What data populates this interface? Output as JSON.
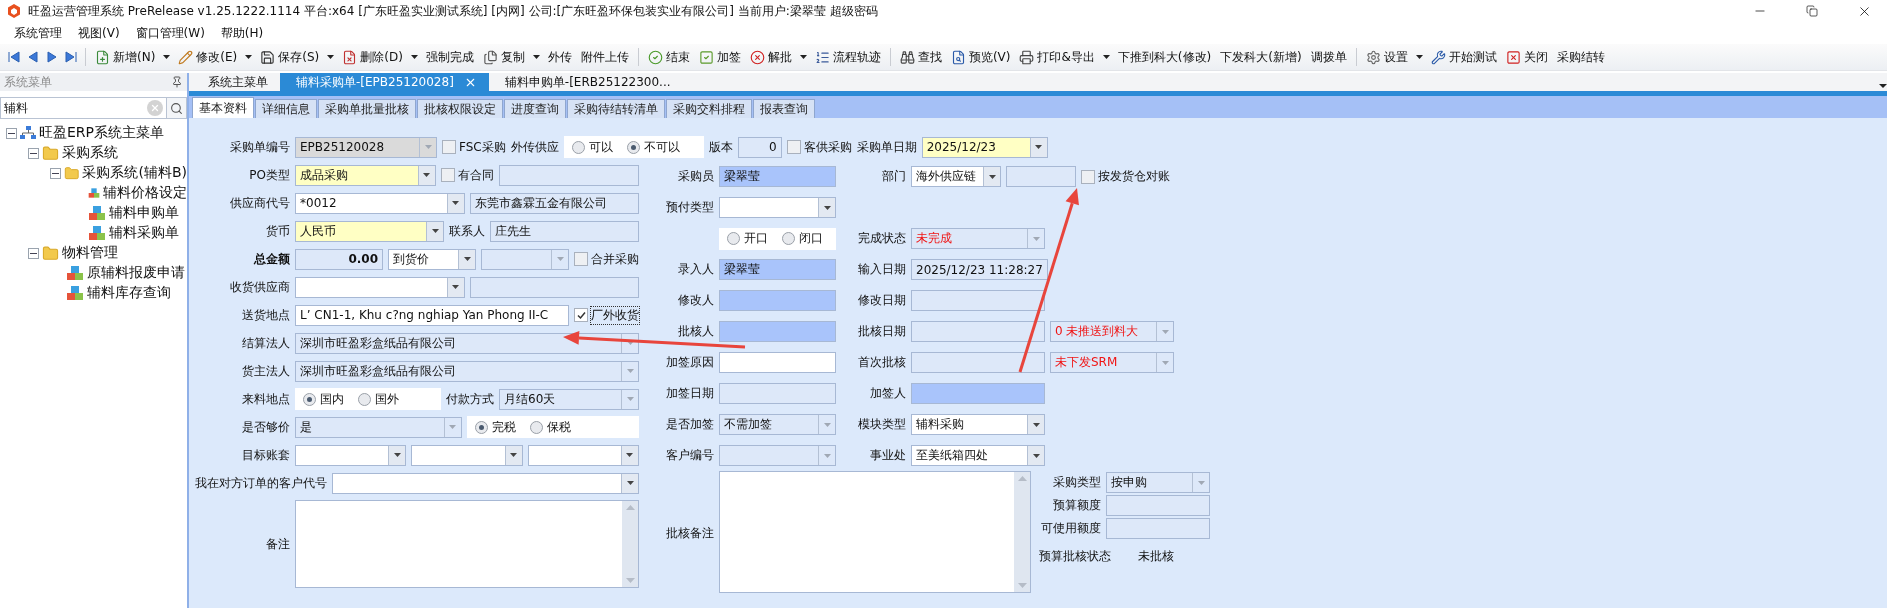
{
  "title_bar": {
    "title": "旺盈运营管理系统 PreRelease v1.25.1222.1114 平台:x64  [广东旺盈实业测试系统] [内网] 公司:[广东旺盈环保包装实业有限公司] 当前用户:梁翠莹  超级密码"
  },
  "menu": [
    "系统管理",
    "视图(V)",
    "窗口管理(W)",
    "帮助(H)"
  ],
  "toolbar": [
    {
      "kind": "separator"
    },
    {
      "kind": "button",
      "label": "新增(N)",
      "dropdown": true
    },
    {
      "kind": "button",
      "label": "修改(E)",
      "dropdown": true
    },
    {
      "kind": "button",
      "label": "保存(S)",
      "dropdown": true
    },
    {
      "kind": "button",
      "label": "删除(D)",
      "dropdown": true
    },
    {
      "kind": "button",
      "label": "强制完成",
      "dropdown": false
    },
    {
      "kind": "button",
      "label": "复制",
      "dropdown": true
    },
    {
      "kind": "button",
      "label": "外传",
      "dropdown": false
    },
    {
      "kind": "button",
      "label": "附件上传",
      "dropdown": false
    },
    {
      "kind": "separator"
    },
    {
      "kind": "button",
      "label": "结束",
      "dropdown": false
    },
    {
      "kind": "button",
      "label": "加签",
      "dropdown": false
    },
    {
      "kind": "button",
      "label": "解批",
      "dropdown": true
    },
    {
      "kind": "button",
      "label": "流程轨迹",
      "dropdown": false
    },
    {
      "kind": "separator"
    },
    {
      "kind": "button",
      "label": "查找",
      "dropdown": false
    },
    {
      "kind": "button",
      "label": "预览(V)",
      "dropdown": false
    },
    {
      "kind": "button",
      "label": "打印&导出",
      "dropdown": true
    },
    {
      "kind": "button",
      "label": "下推到科大(修改)",
      "dropdown": false
    },
    {
      "kind": "button",
      "label": "下发科大(新增)",
      "dropdown": false
    },
    {
      "kind": "button",
      "label": "调拨单",
      "dropdown": false
    },
    {
      "kind": "separator"
    },
    {
      "kind": "button",
      "label": "设置",
      "dropdown": true
    },
    {
      "kind": "button",
      "label": "开始测试",
      "dropdown": false
    },
    {
      "kind": "button",
      "label": "关闭",
      "dropdown": false
    },
    {
      "kind": "button",
      "label": "采购结转",
      "dropdown": false
    }
  ],
  "sidebar": {
    "title": "系统菜单",
    "search": {
      "value": "辅料"
    },
    "tree": [
      {
        "label": "旺盈ERP系统主菜单",
        "expanded": true,
        "children": [
          {
            "label": "采购系统",
            "expanded": true,
            "children": [
              {
                "label": "采购系统(辅料B)",
                "expanded": true,
                "children": [
                  {
                    "label": "辅料价格设定"
                  },
                  {
                    "label": "辅料申购单"
                  },
                  {
                    "label": "辅料采购单"
                  }
                ]
              }
            ]
          },
          {
            "label": "物料管理",
            "expanded": true,
            "children": [
              {
                "label": "原辅料报废申请"
              },
              {
                "label": "辅料库存查询"
              }
            ]
          }
        ]
      }
    ]
  },
  "document_tabs": [
    {
      "label": "系统主菜单",
      "selected": false
    },
    {
      "label": "辅料采购单-[EPB25120028]",
      "selected": true
    },
    {
      "label": "辅料申购单-[ERB25122300...",
      "selected": false
    }
  ],
  "form_tabs": [
    {
      "label": "基本资料",
      "selected": true
    },
    {
      "label": "详细信息",
      "selected": false
    },
    {
      "label": "采购单批量批核",
      "selected": false
    },
    {
      "label": "批核权限设定",
      "selected": false
    },
    {
      "label": "进度查询",
      "selected": false
    },
    {
      "label": "采购待结转清单",
      "selected": false
    },
    {
      "label": "采购交料排程",
      "selected": false
    },
    {
      "label": "报表查询",
      "selected": false
    }
  ],
  "form": {
    "header_row": {
      "label": "采购单编号",
      "items": [
        {
          "kind": "combo",
          "color": "#dadada",
          "editable": false,
          "value": "EPB25120028"
        },
        {
          "kind": "check",
          "label": "FSC采购",
          "checked": false
        },
        {
          "kind": "label",
          "label": "外传供应"
        },
        {
          "kind": "radio",
          "options": [
            {
              "label": "可以",
              "selected": false
            },
            {
              "label": "不可以",
              "selected": true
            }
          ]
        },
        {
          "kind": "label",
          "label": "版本"
        },
        {
          "kind": "text",
          "color": "#dde8f9",
          "value": "0",
          "numeric": true
        },
        {
          "kind": "check",
          "label": "客供采购",
          "checked": false
        },
        {
          "kind": "label",
          "label": "采购单日期"
        },
        {
          "kind": "combo",
          "color": "#ffffc4",
          "editable": true,
          "value": "2025/12/23"
        }
      ]
    },
    "left_rows": [
      {
        "label": "PO类型",
        "items": [
          {
            "kind": "combo",
            "color": "#ffffc4",
            "editable": true,
            "value": "成品采购"
          },
          {
            "kind": "check",
            "label": "有合同",
            "checked": false
          },
          {
            "kind": "text",
            "color": "#dde8f9"
          }
        ]
      },
      {
        "label": "供应商代号",
        "items": [
          {
            "kind": "combo",
            "color": "#ffffff",
            "editable": true,
            "value": "*0012"
          },
          {
            "kind": "text",
            "color": "#dde8f9",
            "value": "东莞市鑫霖五金有限公司"
          }
        ]
      },
      {
        "label": "货币",
        "items": [
          {
            "kind": "combo",
            "color": "#ffffc4",
            "editable": true,
            "value": "人民币"
          },
          {
            "kind": "label",
            "label": "联系人"
          },
          {
            "kind": "text",
            "color": "#dde8f9",
            "value": "庄先生"
          }
        ]
      },
      {
        "label": "总金额",
        "strong": true,
        "items": [
          {
            "kind": "text",
            "color": "#dde8f9",
            "value": "0.00",
            "numeric": true,
            "strong": true
          },
          {
            "kind": "combo",
            "color": "#ffffff",
            "editable": true,
            "value": "到货价"
          },
          {
            "kind": "combo",
            "color": "#dde8f9",
            "editable": false
          },
          {
            "kind": "check",
            "label": "合并采购",
            "checked": false
          }
        ]
      },
      {
        "label": "收货供应商",
        "items": [
          {
            "kind": "combo",
            "color": "#ffffff",
            "editable": true
          },
          {
            "kind": "text",
            "color": "#dde8f9"
          }
        ]
      },
      {
        "label": "送货地点",
        "items": [
          {
            "kind": "text",
            "color": "#ffffff",
            "value": "L’ CN1-1, Khu c?ng nghiap Yan Phong II-C"
          },
          {
            "kind": "check",
            "label": "厂外收货",
            "checked": true,
            "focused": true
          }
        ]
      },
      {
        "label": "结算法人",
        "items": [
          {
            "kind": "combo",
            "color": "#dde8f9",
            "editable": false,
            "value": "深圳市旺盈彩盒纸品有限公司"
          }
        ]
      },
      {
        "label": "货主法人",
        "items": [
          {
            "kind": "combo",
            "color": "#dde8f9",
            "editable": false,
            "value": "深圳市旺盈彩盒纸品有限公司"
          }
        ]
      },
      {
        "label": "来料地点",
        "items": [
          {
            "kind": "radio",
            "options": [
              {
                "label": "国内",
                "selected": true
              },
              {
                "label": "国外",
                "selected": false
              }
            ]
          },
          {
            "kind": "label",
            "label": "付款方式"
          },
          {
            "kind": "combo",
            "color": "#dde8f9",
            "editable": false,
            "value": "月结60天"
          }
        ]
      },
      {
        "label": "是否够价",
        "items": [
          {
            "kind": "combo",
            "color": "#dde8f9",
            "editable": false,
            "value": "是"
          },
          {
            "kind": "radio",
            "options": [
              {
                "label": "完税",
                "selected": true
              },
              {
                "label": "保税",
                "selected": false
              }
            ]
          }
        ]
      },
      {
        "label": "目标账套",
        "items": [
          {
            "kind": "combo",
            "color": "#ffffff",
            "editable": true
          },
          {
            "kind": "combo",
            "color": "#ffffff",
            "editable": true
          },
          {
            "kind": "combo",
            "color": "#ffffff",
            "editable": true
          }
        ]
      },
      {
        "label": "我在对方订单的客户代号",
        "items": [
          {
            "kind": "combo",
            "color": "#ffffff",
            "editable": true
          }
        ]
      },
      {
        "label": "备注",
        "items": [
          {
            "kind": "textarea"
          }
        ]
      }
    ],
    "middle_rows": [
      {
        "label": "采购员",
        "items": [
          {
            "kind": "text",
            "color": "#a9c4fb",
            "value": "梁翠莹"
          }
        ]
      },
      {
        "label": "预付类型",
        "items": [
          {
            "kind": "combo",
            "color": "#ffffff",
            "editable": true
          }
        ]
      },
      {
        "items": [
          {
            "kind": "radio",
            "options": [
              {
                "label": "开口",
                "selected": false
              },
              {
                "label": "闭口",
                "selected": false
              }
            ]
          }
        ]
      },
      {
        "label": "录入人",
        "items": [
          {
            "kind": "text",
            "color": "#a9c4fb",
            "value": "梁翠莹"
          }
        ]
      },
      {
        "label": "修改人",
        "items": [
          {
            "kind": "text",
            "color": "#a9c4fb"
          }
        ]
      },
      {
        "label": "批核人",
        "items": [
          {
            "kind": "text",
            "color": "#a9c4fb"
          }
        ]
      },
      {
        "label": "加签原因",
        "items": [
          {
            "kind": "text",
            "color": "#ffffff"
          }
        ]
      },
      {
        "label": "加签日期",
        "items": [
          {
            "kind": "text",
            "color": "#dde8f9"
          }
        ]
      },
      {
        "label": "是否加签",
        "items": [
          {
            "kind": "combo",
            "color": "#dde8f9",
            "editable": false,
            "value": "不需加签"
          }
        ]
      },
      {
        "label": "客户编号",
        "items": [
          {
            "kind": "combo",
            "color": "#dde8f9",
            "editable": false
          }
        ]
      }
    ],
    "right_rows": [
      {
        "label": "部门",
        "items": [
          {
            "kind": "combo",
            "color": "#ffffff",
            "editable": true,
            "value": "海外供应链"
          },
          {
            "kind": "text",
            "color": "#dde8f9"
          },
          {
            "kind": "check",
            "label": "按发货仓对账",
            "checked": false
          }
        ]
      },
      {
        "label": "完成状态",
        "items": [
          {
            "kind": "combo",
            "color": "#dde8f9",
            "editable": false,
            "value": "未完成",
            "alert": true
          }
        ]
      },
      {
        "label": "输入日期",
        "items": [
          {
            "kind": "text",
            "color": "#dde8f9",
            "value": "2025/12/23 11:28:27"
          }
        ]
      },
      {
        "label": "修改日期",
        "items": [
          {
            "kind": "text",
            "color": "#dde8f9"
          }
        ]
      },
      {
        "label": "批核日期",
        "items": [
          {
            "kind": "text",
            "color": "#dde8f9"
          },
          {
            "kind": "combo",
            "color": "#dde8f9",
            "editable": false,
            "value": "0 未推送到料大",
            "alert": true
          }
        ]
      },
      {
        "label": "首次批核",
        "items": [
          {
            "kind": "text",
            "color": "#dde8f9"
          },
          {
            "kind": "combo",
            "color": "#dde8f9",
            "editable": false,
            "value": "未下发SRM",
            "alert": true
          }
        ]
      },
      {
        "label": "加签人",
        "items": [
          {
            "kind": "text",
            "color": "#a9c4fb"
          }
        ]
      },
      {
        "label": "模块类型",
        "items": [
          {
            "kind": "combo",
            "color": "#ffffff",
            "editable": true,
            "value": "辅料采购"
          }
        ]
      },
      {
        "label": "事业处",
        "items": [
          {
            "kind": "combo",
            "color": "#ffffff",
            "editable": true,
            "value": "至美纸箱四处"
          }
        ]
      }
    ],
    "approval_notes": {
      "label": "批核备注"
    },
    "budget_panel": [
      {
        "label": "采购类型",
        "items": [
          {
            "kind": "combo",
            "color": "#dde8f9",
            "editable": false,
            "value": "按申购"
          }
        ]
      },
      {
        "label": "预算额度",
        "items": [
          {
            "kind": "text",
            "color": "#dde8f9"
          }
        ]
      },
      {
        "label": "可使用额度",
        "items": [
          {
            "kind": "text",
            "color": "#dde8f9"
          }
        ]
      },
      {
        "label": "预算批核状态",
        "items": [
          {
            "kind": "plain",
            "value": "未批核"
          }
        ]
      }
    ]
  }
}
